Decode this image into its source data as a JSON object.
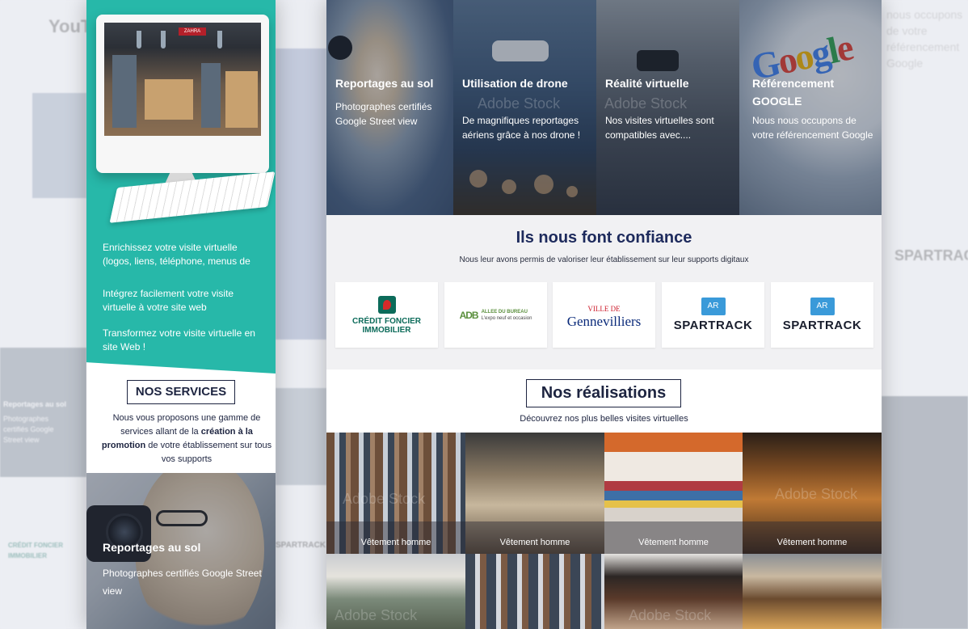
{
  "left_phone": {
    "hero_points": [
      "Enrichissez votre visite virtuelle (logos, liens, téléphone, menus de",
      "Intégrez facilement votre visite virtuelle à votre site web",
      "Transformez votre visite virtuelle en site Web !"
    ],
    "screen_sign": "ZAHRA",
    "services_title": "NOS SERVICES",
    "services_desc_before": "Nous vous proposons une gamme de services allant de la ",
    "services_desc_bold": "création à la promotion",
    "services_desc_after": " de votre établissement sur tous vos supports",
    "photo_title": "Reportages au sol",
    "photo_text": "Photographes certifiés Google Street view"
  },
  "services": [
    {
      "title": "Reportages au sol",
      "text": "Photographes certifiés Google Street view"
    },
    {
      "title": "Utilisation de drone",
      "text": "De magnifiques reportages aériens grâce à nos drone !"
    },
    {
      "title": "Réalité virtuelle",
      "text": "Nos visites virtuelles sont compatibles avec...."
    },
    {
      "title": "Référencement GOOGLE",
      "text": "Nous nous occupons de votre référencement Google"
    }
  ],
  "google_logo": [
    "G",
    "o",
    "o",
    "g",
    "l",
    "e"
  ],
  "trust": {
    "title": "Ils nous font confiance",
    "subtitle": "Nous leur avons permis de valoriser leur établissement sur leur supports digitaux",
    "logos": {
      "credit_foncier": "CRÉDIT FONCIER IMMOBILIER",
      "adb_mark": "ADB",
      "adb_name": "ALLEE DU BUREAU",
      "adb_tag": "L'expo neuf et occasion",
      "genn_small": "VILLE DE",
      "genn_name": "Gennevilliers",
      "ar": "AR",
      "spartrack": "SPARTRACK"
    }
  },
  "realisations": {
    "title": "Nos réalisations",
    "subtitle": "Découvrez nos plus belles visites virtuelles",
    "tiles": [
      "Vêtement homme",
      "Vêtement homme",
      "Vêtement homme",
      "Vêtement homme"
    ]
  },
  "watermark": "Adobe Stock",
  "ghost": {
    "youtube": "YouTube",
    "right_text": "nous occupons de votre référencement Google",
    "right_logo": "SPARTRACK",
    "left_logo": "CRÉDIT FONCIER IMMOBILIER",
    "left_title": "Reportages au sol",
    "left_text": "Photographes certifiés Google Street view"
  },
  "colors": {
    "teal": "#27b8a9",
    "navy": "#1d2a5c"
  }
}
